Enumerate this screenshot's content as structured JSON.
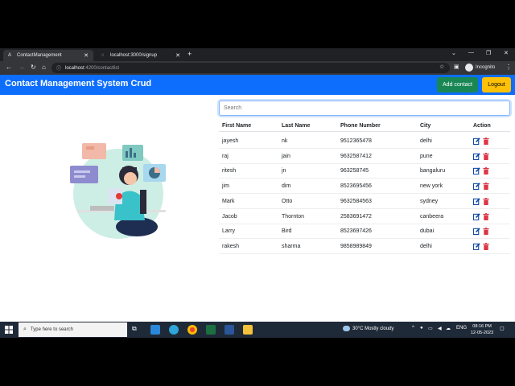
{
  "browser": {
    "tabs": [
      {
        "label": "ContactManagement",
        "active": true
      },
      {
        "label": "localhost:3000/signup",
        "active": false
      }
    ],
    "url_host": "localhost",
    "url_path": ":4200/contactlist",
    "profile_label": "Incognito"
  },
  "app": {
    "title": "Contact Management System Crud",
    "add_label": "Add contact",
    "logout_label": "Logout",
    "colors": {
      "nav": "#0d6efd",
      "add": "#198754",
      "logout": "#ffc107"
    }
  },
  "search": {
    "placeholder": "Search",
    "value": ""
  },
  "table": {
    "headers": [
      "First Name",
      "Last Name",
      "Phone Number",
      "City",
      "Action"
    ],
    "rows": [
      [
        "jayesh",
        "nk",
        "9512365478",
        "delhi"
      ],
      [
        "raj",
        "jain",
        "9632587412",
        "pune"
      ],
      [
        "ritesh",
        "jn",
        "963258745",
        "bangaluru"
      ],
      [
        "jim",
        "dim",
        "8523695456",
        "new york"
      ],
      [
        "Mark",
        "Otto",
        "9632584563",
        "sydney"
      ],
      [
        "Jacob",
        "Thornton",
        "2583691472",
        "canbeera"
      ],
      [
        "Larry",
        "Bird",
        "8523697426",
        "dubai"
      ],
      [
        "rakesh",
        "sharma",
        "9858989849",
        "delhi"
      ]
    ]
  },
  "taskbar": {
    "search_placeholder": "Type here to search",
    "weather": "30°C  Mostly cloudy",
    "lang": "ENG",
    "time": "08:16 PM",
    "date": "12-05-2023"
  }
}
